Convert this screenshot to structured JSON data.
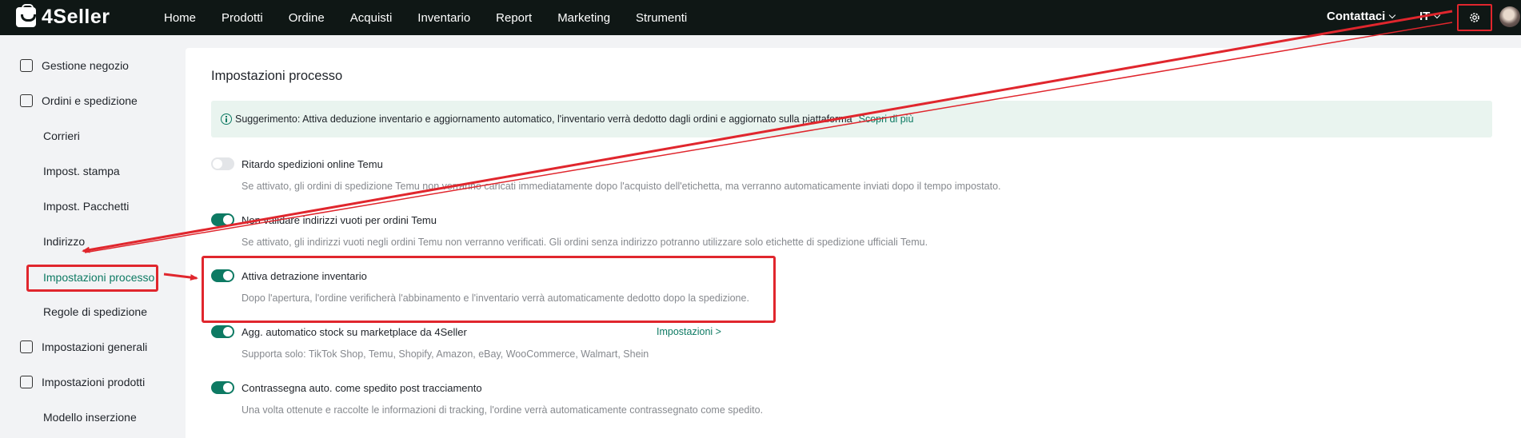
{
  "brand": {
    "name": "4Seller"
  },
  "nav": [
    "Home",
    "Prodotti",
    "Ordine",
    "Acquisti",
    "Inventario",
    "Report",
    "Marketing",
    "Strumenti"
  ],
  "header": {
    "contact": "Contattaci",
    "language": "IT"
  },
  "sidebar": {
    "items": [
      {
        "label": "Gestione negozio",
        "icon": "shop-icon"
      },
      {
        "label": "Ordini e spedizione",
        "icon": "order-icon"
      },
      {
        "label": "Corrieri"
      },
      {
        "label": "Impost. stampa"
      },
      {
        "label": "Impost. Pacchetti"
      },
      {
        "label": "Indirizzo"
      },
      {
        "label": "Impostazioni processo",
        "active": true
      },
      {
        "label": "Regole di spedizione"
      },
      {
        "label": "Impostazioni generali",
        "icon": "printer-icon"
      },
      {
        "label": "Impostazioni prodotti",
        "icon": "upload-box-icon"
      },
      {
        "label": "Modello inserzione"
      }
    ]
  },
  "main": {
    "title": "Impostazioni processo",
    "tip": {
      "text": "Suggerimento: Attiva deduzione inventario e aggiornamento automatico, l'inventario verrà dedotto dagli ordini e aggiornato sulla piattaforma",
      "link": "Scopri di più"
    },
    "options": [
      {
        "title": "Ritardo spedizioni online Temu",
        "desc": "Se attivato, gli ordini di spedizione Temu non verranno caricati immediatamente dopo l'acquisto dell'etichetta, ma verranno automaticamente inviati dopo il tempo impostato.",
        "enabled": false
      },
      {
        "title": "Non validare indirizzi vuoti per ordini Temu",
        "desc": "Se attivato, gli indirizzi vuoti negli ordini Temu non verranno verificati. Gli ordini senza indirizzo potranno utilizzare solo etichette di spedizione ufficiali Temu.",
        "enabled": true
      },
      {
        "title": "Attiva detrazione inventario",
        "desc": "Dopo l'apertura, l'ordine verificherà l'abbinamento e l'inventario verrà automaticamente dedotto dopo la spedizione.",
        "enabled": true
      },
      {
        "title": "Agg. automatico stock su marketplace da 4Seller",
        "desc": "Supporta solo: TikTok Shop, Temu, Shopify, Amazon, eBay, WooCommerce, Walmart, Shein",
        "enabled": true,
        "link": "Impostazioni >"
      },
      {
        "title": "Contrassegna auto. come spedito post tracciamento",
        "desc": "Una volta ottenute e raccolte le informazioni di tracking, l'ordine verrà automaticamente contrassegnato come spedito.",
        "enabled": true
      }
    ]
  },
  "colors": {
    "accent": "#0d7a63",
    "topbar": "#0f1715",
    "highlight": "#e0262d"
  }
}
